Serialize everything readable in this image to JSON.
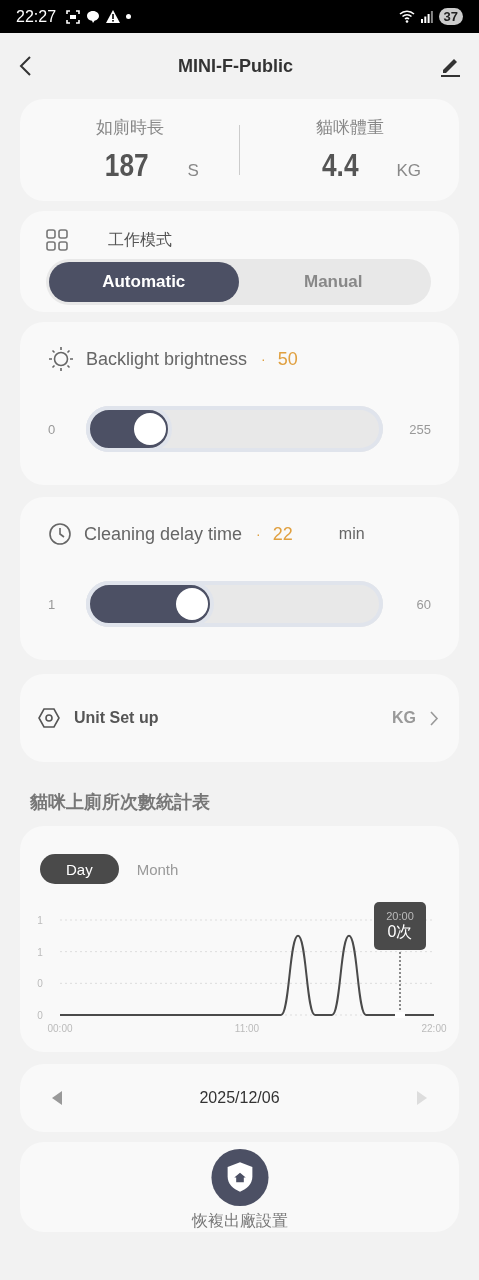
{
  "status_bar": {
    "time": "22:27",
    "battery": "37"
  },
  "header": {
    "title": "MINI-F-Public"
  },
  "stats": [
    {
      "label": "如廁時長",
      "value": "187",
      "unit": "S"
    },
    {
      "label": "貓咪體重",
      "value": "4.4",
      "unit": "KG"
    }
  ],
  "work_mode": {
    "title": "工作模式",
    "options": [
      {
        "label": "Automatic",
        "selected": true
      },
      {
        "label": "Manual",
        "selected": false
      }
    ]
  },
  "sliders": [
    {
      "kind": "brightness",
      "label": "Backlight brightness",
      "separator": "·",
      "value": "50",
      "min": "0",
      "max": "255",
      "level": 0.29
    },
    {
      "kind": "delay",
      "label": "Cleaning delay time",
      "separator": "·",
      "value": "22",
      "unit": "min",
      "min": "1",
      "max": "60",
      "level": 0.43
    }
  ],
  "unit_setting": {
    "label": "Unit Set up",
    "value": "KG"
  },
  "stats_section": {
    "title": "貓咪上廁所次數統計表",
    "tabs": [
      {
        "label": "Day",
        "selected": true
      },
      {
        "label": "Month",
        "selected": false
      }
    ],
    "chart_data": {
      "type": "line",
      "xlim": [
        0,
        22
      ],
      "x": [
        0,
        1,
        2,
        3,
        4,
        5,
        6,
        7,
        8,
        9,
        10,
        11,
        12,
        13,
        14,
        15,
        16,
        17,
        18,
        19,
        20,
        21,
        22
      ],
      "xticks": [
        {
          "value": 0,
          "label": "00:00"
        },
        {
          "value": 11,
          "label": "11:00"
        },
        {
          "value": 22,
          "label": "22:00"
        }
      ],
      "yticks": [
        {
          "value": 0,
          "label": "0"
        },
        {
          "value": 0.4,
          "label": "0"
        },
        {
          "value": 0.8,
          "label": "1"
        },
        {
          "value": 1.2,
          "label": "1"
        }
      ],
      "ylim": [
        0,
        1.2
      ],
      "series": [
        {
          "color": "#4a4a4a",
          "values": [
            0,
            0,
            0,
            0,
            0,
            0,
            0,
            0,
            0,
            0,
            0,
            0,
            0,
            0,
            1,
            0,
            0,
            1,
            0,
            0,
            0,
            0,
            0
          ]
        }
      ]
    },
    "tooltip": {
      "time": "20:00",
      "count": "0次"
    }
  },
  "date_nav": {
    "date": "2025/12/06",
    "prev": {
      "disabled": false
    },
    "next": {
      "disabled": true
    }
  },
  "reset": {
    "label": "恢複出廠設置"
  }
}
